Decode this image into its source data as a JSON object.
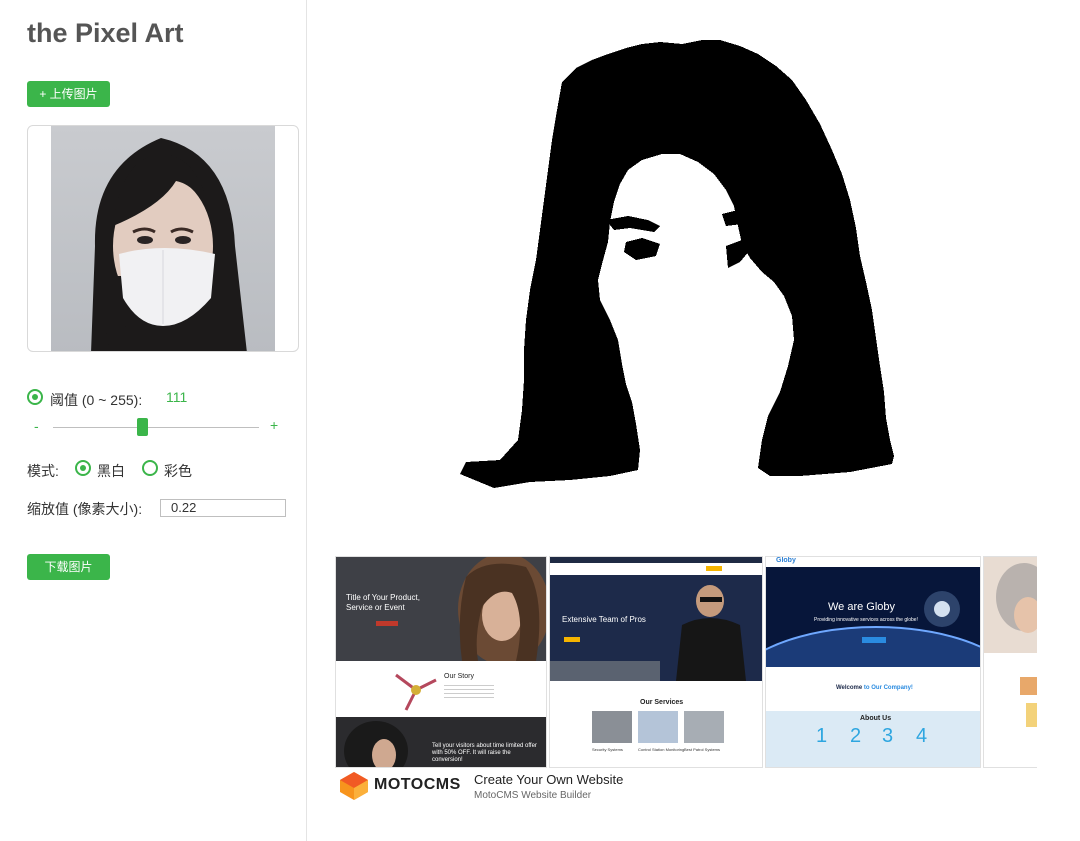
{
  "app": {
    "title": "the Pixel Art"
  },
  "upload_button": {
    "label": "+ 上传图片"
  },
  "threshold": {
    "label": "阈值 (0 ~ 255):",
    "value": "111",
    "minus": "-",
    "plus": "+",
    "level": 0.435
  },
  "mode": {
    "label": "模式:",
    "options": [
      "黑白",
      "彩色"
    ],
    "selected": "黑白"
  },
  "scale": {
    "label": "缩放值 (像素大小):",
    "value": "0.22"
  },
  "download_button": {
    "label": "下载图片"
  },
  "ad": {
    "brand": "MOTOCMS",
    "title": "Create Your Own Website",
    "subtitle": "MotoCMS Website Builder",
    "tiles": [
      {
        "heading": "Title of Your Product, Service or Event",
        "section": "Our Story",
        "promo": "Tell your visitors about time limited offer with 50% OFF. It will raise the conversion!"
      },
      {
        "heading": "Extensive Team of Pros",
        "section": "Our Services",
        "services": [
          "Security Systems",
          "Control Station Monitoring",
          "Best Patrol Systems"
        ]
      },
      {
        "brand": "Globy",
        "heading": "We are Globy",
        "tagline": "Providing innovative services across the globe!",
        "welcome_prefix": "Welcome",
        "welcome_suffix": "to Our Company!",
        "section": "About Us",
        "numbers": [
          "1",
          "2",
          "3",
          "4"
        ]
      }
    ]
  },
  "colors": {
    "accent": "#3bb54a",
    "ad_accent": "#f7941d"
  }
}
